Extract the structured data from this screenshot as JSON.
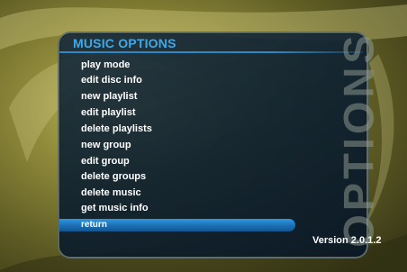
{
  "menu": {
    "title": "MUSIC OPTIONS",
    "items": [
      {
        "label": "play mode"
      },
      {
        "label": "edit disc info"
      },
      {
        "label": "new playlist"
      },
      {
        "label": "edit playlist"
      },
      {
        "label": "delete playlists"
      },
      {
        "label": "new group"
      },
      {
        "label": "edit group"
      },
      {
        "label": "delete groups"
      },
      {
        "label": "delete music"
      },
      {
        "label": "get music info"
      }
    ],
    "selected": {
      "label": "return"
    }
  },
  "side_watermark": "OPTIONS",
  "version": "Version 2.0.1.2",
  "colors": {
    "title": "#3fa9e8",
    "highlight": "#1f7fc8",
    "panel": "#14283c",
    "background": "#6e6a2a"
  }
}
